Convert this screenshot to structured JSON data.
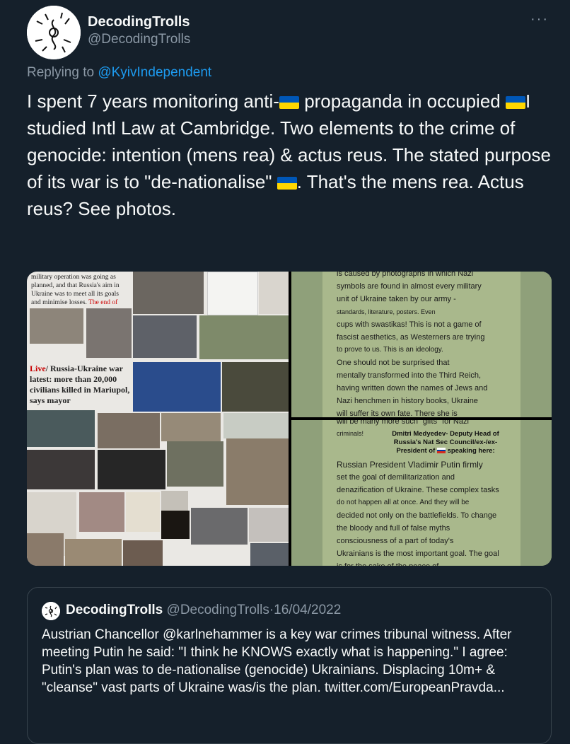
{
  "tweet": {
    "display_name": "DecodingTrolls",
    "handle": "@DecodingTrolls",
    "more_label": "···",
    "replying_to_prefix": "Replying to ",
    "replying_to_handle": "@KyivIndependent",
    "text_part1": "I spent 7 years monitoring anti-",
    "text_part2": " propaganda in occupied ",
    "text_part3": "I studied Intl Law at Cambridge. Two elements to the crime of genocide: intention (mens rea) & actus reus. The stated purpose of its war is to \"de-nationalise\" ",
    "text_part4": ". That's the mens rea. Actus reus? See photos."
  },
  "media": {
    "left_collage": {
      "headline_top": "military operation was going as planned, and that Russia's aim in Ukraine was to meet all its goals and minimise losses.",
      "headline_top_red": "The end of",
      "live_label": "Live",
      "live_headline": "/ Russia-Ukraine war latest: more than 20,000 civilians killed in Mariupol, says mayor"
    },
    "right_top_lines": [
      "is caused by photographs in which Nazi",
      "symbols are found in almost every military",
      "unit of Ukraine taken by our army -",
      "standards, literature, posters. Even",
      "cups with swastikas! This is not a game of",
      "fascist aesthetics, as Westerners are trying",
      "to prove to us. This is an ideology.",
      "One should not be surprised that",
      "mentally transformed into the Third Reich,",
      "having written down the names of Jews and",
      "Nazi henchmen in history books, Ukraine",
      "will suffer its own fate. There she is"
    ],
    "right_bottom_header": "will be many more such \"gifts\" for Nazi",
    "right_bottom_criminals": "criminals!",
    "right_bottom_caption": "Dmitri Medyedev- Deputy Head of Russia's Nat Sec Council/ex-/ex-President of",
    "right_bottom_caption_end": "speaking here:",
    "right_bottom_lines": [
      "Russian President Vladimir Putin firmly",
      "set the goal of demilitarization and",
      "denazification of Ukraine. These complex tasks",
      "do not happen all at once. And they will be",
      "decided not only on the battlefields. To change",
      "the bloody and full of false myths",
      "consciousness of a part of today's",
      "Ukrainians is the most important goal. The goal",
      "is for the sake of the peace of"
    ]
  },
  "quote": {
    "display_name": "DecodingTrolls",
    "handle": "@DecodingTrolls",
    "separator": "·",
    "date": "16/04/2022",
    "text": "Austrian Chancellor @karlnehammer is a key war crimes tribunal witness. After meeting Putin he said: \"I think he KNOWS exactly what is happening.\" I agree: Putin's plan was to de-nationalise (genocide) Ukrainians. Displacing 10m+ & \"cleanse\" vast parts of Ukraine was/is the plan. twitter.com/EuropeanPravda..."
  },
  "colors": {
    "background": "#15202b",
    "link": "#1d9bf0",
    "secondary_text": "#8b98a5",
    "ukraine_blue": "#0057b7",
    "ukraine_yellow": "#ffd700"
  },
  "icons": [
    "avatar-image",
    "ukraine-flag-icon",
    "russia-flag-icon",
    "more-icon"
  ]
}
